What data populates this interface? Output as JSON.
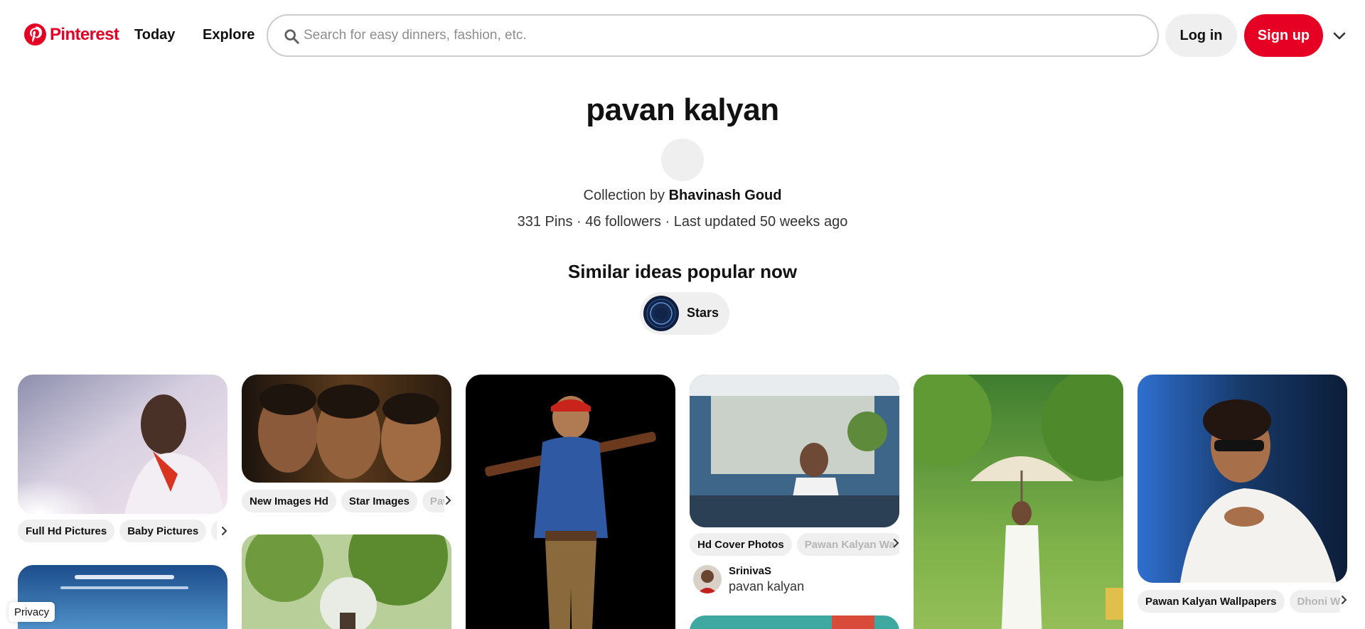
{
  "header": {
    "brand": "Pinterest",
    "nav": {
      "today": "Today",
      "explore": "Explore"
    },
    "search": {
      "placeholder": "Search for easy dinners, fashion, etc.",
      "value": ""
    },
    "login_label": "Log in",
    "signup_label": "Sign up",
    "brand_color": "#e60023"
  },
  "board": {
    "title": "pavan kalyan",
    "collection_prefix": "Collection by",
    "owner": "Bhavinash Goud",
    "stats": "331 Pins · 46 followers · Last updated 50 weeks ago"
  },
  "similar": {
    "title": "Similar ideas popular now",
    "chips": [
      {
        "label": "Stars",
        "icon": "stars-thumbnail"
      }
    ]
  },
  "pins": [
    {
      "tags": [
        "Full Hd Pictures",
        "Baby Pictures",
        "Pa"
      ]
    },
    {
      "tags": [
        "New Images Hd",
        "Star Images",
        "Paw"
      ]
    },
    {},
    {
      "tags": [
        "Hd Cover Photos",
        "Pawan Kalyan Wa"
      ],
      "pinner": {
        "name": "SrinivaS",
        "board": "pavan kalyan"
      }
    },
    {},
    {
      "tags": [
        "Pawan Kalyan Wallpapers",
        "Dhoni W"
      ]
    }
  ],
  "footer": {
    "privacy": "Privacy"
  }
}
